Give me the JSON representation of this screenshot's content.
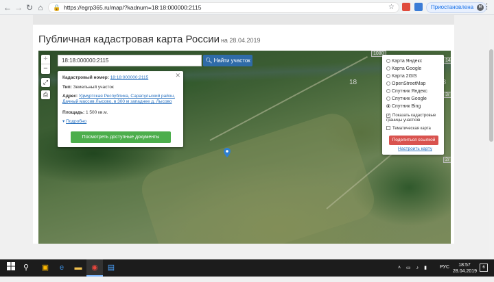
{
  "browser": {
    "url": "https://egrp365.ru/map/?kadnum=18:18:000000:2115",
    "paused_label": "Приостановлена",
    "avatar_letter": "R"
  },
  "page": {
    "title": "Публичная кадастровая карта России",
    "date": "на 28.04.2019"
  },
  "map": {
    "search": {
      "value": "18:18:000000:2115",
      "button_label": "Найти участок"
    },
    "zoom_in": "+",
    "zoom_out": "−",
    "labels": {
      "tile_a": "1080",
      "center_num": "18",
      "right_num": "18",
      "edge_a": "14/",
      "edge_b": "3/",
      "edge_c": "2/",
      "tile_b": "18"
    },
    "popup": {
      "cadnum_label": "Кадастровый номер:",
      "cadnum_value": "18:18:000000:2115",
      "type_label": "Тип:",
      "type_value": "Земельный участок",
      "address_label": "Адрес:",
      "address_value": "Удмуртская Республика, Сарапульский район, Дачный массив Лысово, в 300 м западнее д. Лысово",
      "area_label": "Площадь:",
      "area_value": "1 500 кв.м.",
      "more_label": "Подробно",
      "docs_button": "Посмотреть доступные документы"
    },
    "layers": {
      "options": [
        {
          "label": "Карта Яндекс",
          "selected": false
        },
        {
          "label": "Карта Google",
          "selected": false
        },
        {
          "label": "Карта 2GIS",
          "selected": false
        },
        {
          "label": "OpenStreetMap",
          "selected": false
        },
        {
          "label": "Спутник Яндекс",
          "selected": false
        },
        {
          "label": "Спутник Google",
          "selected": false
        },
        {
          "label": "Спутник Bing",
          "selected": true
        }
      ],
      "checkbox_cadastral": "Показать кадастровые границы участков",
      "checkbox_thematic": "Тематическая карта",
      "share_button": "Поделиться ссылкой",
      "setup_link": "Настроить карту"
    }
  },
  "taskbar": {
    "lang": "РУС",
    "time": "18:57",
    "date": "28.04.2019",
    "notif_count": "6"
  },
  "colors": {
    "search_button": "#2f6ba8",
    "docs_button": "#4cae4c",
    "share_button": "#d9534f",
    "link": "#2a72c0"
  }
}
